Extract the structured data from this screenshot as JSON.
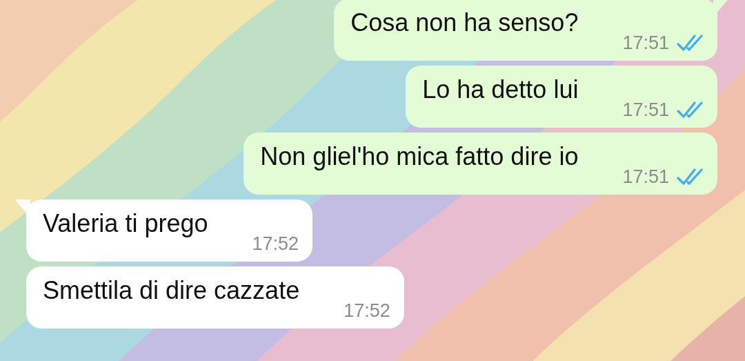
{
  "messages": [
    {
      "kind": "outgoing",
      "text": "Cosa non ha senso?",
      "time": "17:51",
      "read": true
    },
    {
      "kind": "outgoing",
      "text": "Lo ha detto lui",
      "time": "17:51",
      "read": true
    },
    {
      "kind": "outgoing",
      "text": "Non gliel'ho mica fatto dire io",
      "time": "17:51",
      "read": true
    },
    {
      "kind": "incoming",
      "text": "Valeria ti prego",
      "time": "17:52"
    },
    {
      "kind": "incoming",
      "text": "Smettila di dire cazzate",
      "time": "17:52"
    }
  ]
}
